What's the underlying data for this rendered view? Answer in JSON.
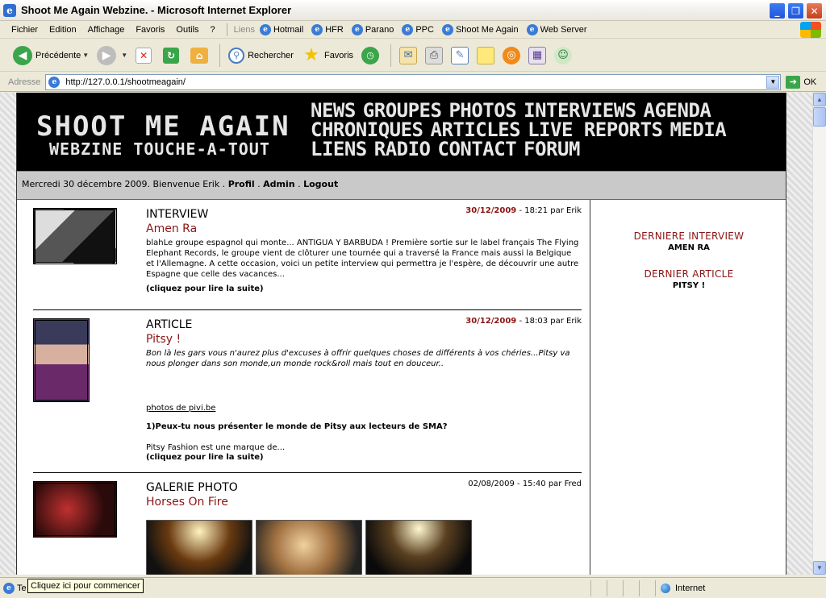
{
  "window": {
    "title": "Shoot Me Again Webzine. - Microsoft Internet Explorer"
  },
  "menu": {
    "items": [
      "Fichier",
      "Edition",
      "Affichage",
      "Favoris",
      "Outils",
      "?"
    ],
    "links_label": "Liens",
    "links": [
      "Hotmail",
      "HFR",
      "Parano",
      "PPC",
      "Shoot Me Again",
      "Web Server"
    ]
  },
  "toolbar": {
    "back": "Précédente",
    "search": "Rechercher",
    "favorites": "Favoris"
  },
  "address": {
    "label": "Adresse",
    "url": "http://127.0.0.1/shootmeagain/",
    "go": "OK"
  },
  "site": {
    "logo_main": "SHOOT ME AGAIN",
    "logo_sub": "WEBZINE TOUCHE-A-TOUT",
    "nav": [
      "NEWS",
      "GROUPES",
      "PHOTOS",
      "INTERVIEWS",
      "AGENDA",
      "CHRONIQUES",
      "ARTICLES",
      "LIVE REPORTS",
      "MEDIA",
      "LIENS",
      "RADIO",
      "CONTACT",
      "FORUM"
    ],
    "info": {
      "date_welcome": "Mercredi 30 décembre 2009. Bienvenue Erik . ",
      "profil": "Profil",
      "admin": "Admin",
      "logout": "Logout",
      "sep": " . "
    }
  },
  "sidebar": {
    "interview_head": "DERNIERE INTERVIEW",
    "interview_link": "AMEN RA",
    "article_head": "DERNIER ARTICLE",
    "article_link": "PITSY !"
  },
  "articles": [
    {
      "type": "INTERVIEW",
      "title": "Amen Ra",
      "date": "30/12/2009",
      "time_author": " - 18:21 par Erik",
      "text": "blahLe groupe espagnol qui monte... ANTIGUA Y BARBUDA ! Première sortie sur le label français The Flying Elephant Records, le groupe vient de clôturer une tournée qui a traversé la France mais aussi la Belgique et l'Allemagne. A cette occasion, voici un petite interview qui permettra je l'espère, de découvrir une autre Espagne que celle des vacances...",
      "more": "(cliquez pour lire la suite)"
    },
    {
      "type": "ARTICLE",
      "title": "Pitsy !",
      "date": "30/12/2009",
      "time_author": " - 18:03 par Erik",
      "text": "Bon là les gars vous n'aurez plus d'excuses à offrir quelques choses de différents à vos chéries...Pitsy va nous plonger dans son monde,un monde rock&roll mais tout en douceur..",
      "photo_credit": "photos de pivi.be",
      "question": "1)Peux-tu nous présenter le monde de Pitsy aux lecteurs de SMA?",
      "answer": "Pitsy Fashion est une marque de...",
      "more": "(cliquez pour lire la suite)"
    },
    {
      "type": "GALERIE PHOTO",
      "title": "Horses On Fire",
      "date_full": "02/08/2009 - 15:40 par Fred"
    }
  ],
  "status": {
    "tooltip": "Cliquez ici pour commencer",
    "left_text": "Te",
    "zone": "Internet"
  }
}
